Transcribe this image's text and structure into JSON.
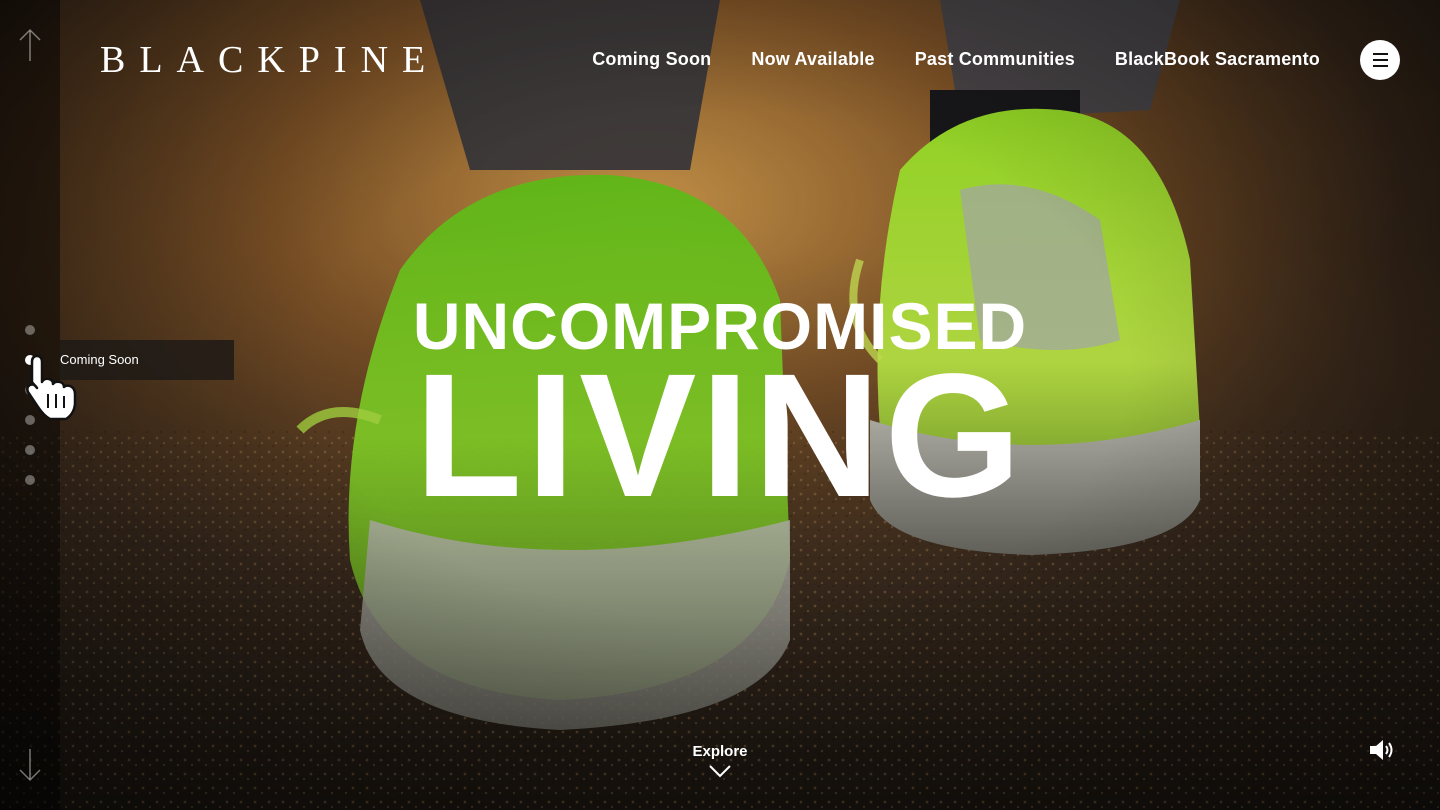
{
  "brand": {
    "logo_text": "BLACKPINE"
  },
  "nav": {
    "items": [
      {
        "label": "Coming Soon"
      },
      {
        "label": "Now Available"
      },
      {
        "label": "Past Communities"
      },
      {
        "label": "BlackBook Sacramento"
      }
    ],
    "menu_icon": "hamburger-icon"
  },
  "hero": {
    "line1": "UNCOMPROMISED",
    "line2": "LIVING",
    "background": "close-up of neon-green running shoes walking on asphalt at sunset"
  },
  "section_nav": {
    "dot_count": 6,
    "active_index": 1,
    "tooltip_label": "Coming Soon"
  },
  "footer": {
    "explore_label": "Explore",
    "explore_icon": "chevron-down-icon",
    "sound_icon": "speaker-icon"
  },
  "colors": {
    "text": "#ffffff",
    "accent_green": "#9be51c",
    "rail": "#000000"
  }
}
